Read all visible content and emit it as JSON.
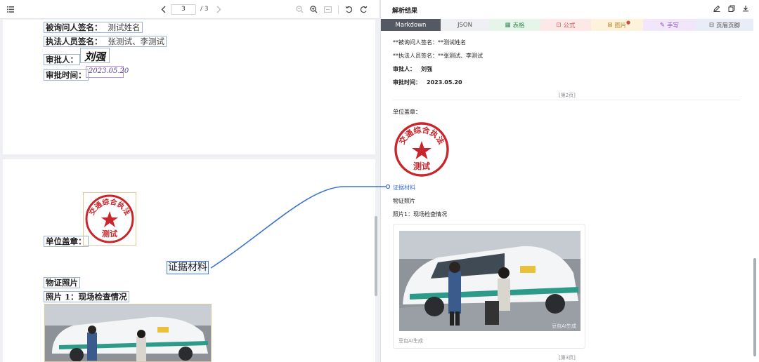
{
  "viewer": {
    "page_current": "3",
    "page_total": "/ 3"
  },
  "doc": {
    "interviewee_label": "被询问人签名：",
    "interviewee_value": "测试姓名",
    "officers_label": "执法人员签名：",
    "officers_value": "张测试、李测试",
    "approver_label": "审批人：",
    "approver_sig": "刘强",
    "approve_time_label": "审批时间：",
    "approve_time_sig": "2023.05.20",
    "seal_label": "单位盖章：",
    "evidence_heading": "证据材料",
    "physical_evidence": "物证照片",
    "photo1_caption": "照片 1：现场检查情况",
    "seal_text_arc": "交通综合执法",
    "seal_text_center": "测试"
  },
  "panel": {
    "title": "解析结果",
    "tabs": [
      {
        "label": "Markdown",
        "icon": ""
      },
      {
        "label": "JSON",
        "icon": ""
      },
      {
        "label": "表格",
        "icon": "▦"
      },
      {
        "label": "公式",
        "icon": "⊡"
      },
      {
        "label": "图片",
        "icon": "⊠",
        "sup": "●"
      },
      {
        "label": "手写",
        "icon": "✎"
      },
      {
        "label": "页眉页脚",
        "icon": "⊟"
      }
    ],
    "lines": {
      "interviewee": "**被询问人签名：**测试姓名",
      "officers": "**执法人员签名：**张测试、李测试",
      "approver_label": "审批人：",
      "approver_value": "刘强",
      "approve_time_label": "审批时间：",
      "approve_time_value": "2023.05.20",
      "page2": "[第2页]",
      "seal_label": "单位盖章：",
      "evidence_link": "证据材料",
      "physical_evidence": "物证照片",
      "photo1_caption": "照片1：现场检查情况",
      "ai_note": "豆包AI生成",
      "page3": "[第3页]",
      "watermark": "豆包AI生成"
    }
  },
  "colors": {
    "accent": "#3a72d0",
    "seal_red": "#c8262c",
    "tab_active": "#555a62",
    "tab_table": "#e6f5ea",
    "tab_formula": "#fde8e8",
    "tab_image": "#fdf3dd",
    "tab_handwriting": "#f1e6fa",
    "tab_header": "#e9edf5"
  }
}
